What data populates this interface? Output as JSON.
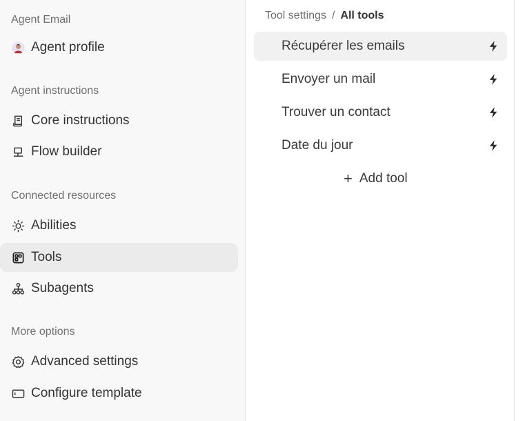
{
  "sidebar": {
    "sections": [
      {
        "title": "Agent Email"
      },
      {
        "title": "Agent instructions"
      },
      {
        "title": "Connected resources"
      },
      {
        "title": "More options"
      }
    ],
    "items": [
      {
        "label": "Agent profile",
        "icon": "avatar"
      },
      {
        "label": "Core instructions",
        "icon": "document-icon"
      },
      {
        "label": "Flow builder",
        "icon": "flow-icon"
      },
      {
        "label": "Abilities",
        "icon": "sun-icon"
      },
      {
        "label": "Tools",
        "icon": "tools-icon",
        "active": true
      },
      {
        "label": "Subagents",
        "icon": "hierarchy-icon"
      },
      {
        "label": "Advanced settings",
        "icon": "gear-icon"
      },
      {
        "label": "Configure template",
        "icon": "template-icon"
      }
    ]
  },
  "main": {
    "breadcrumb": {
      "parent": "Tool settings",
      "separator": "/",
      "current": "All tools"
    },
    "tools": [
      {
        "label": "Récupérer les emails",
        "icon": "bolt-icon"
      },
      {
        "label": "Envoyer un mail",
        "icon": "bolt-icon"
      },
      {
        "label": "Trouver un contact",
        "icon": "bolt-icon"
      },
      {
        "label": "Date du jour",
        "icon": "bolt-icon"
      }
    ],
    "add_tool": {
      "icon": "+",
      "label": "Add tool"
    }
  },
  "colors": {
    "sidebar_bg": "#f8f8f8",
    "active_bg": "#ebebeb",
    "hover_bg": "#f1f1f1"
  }
}
